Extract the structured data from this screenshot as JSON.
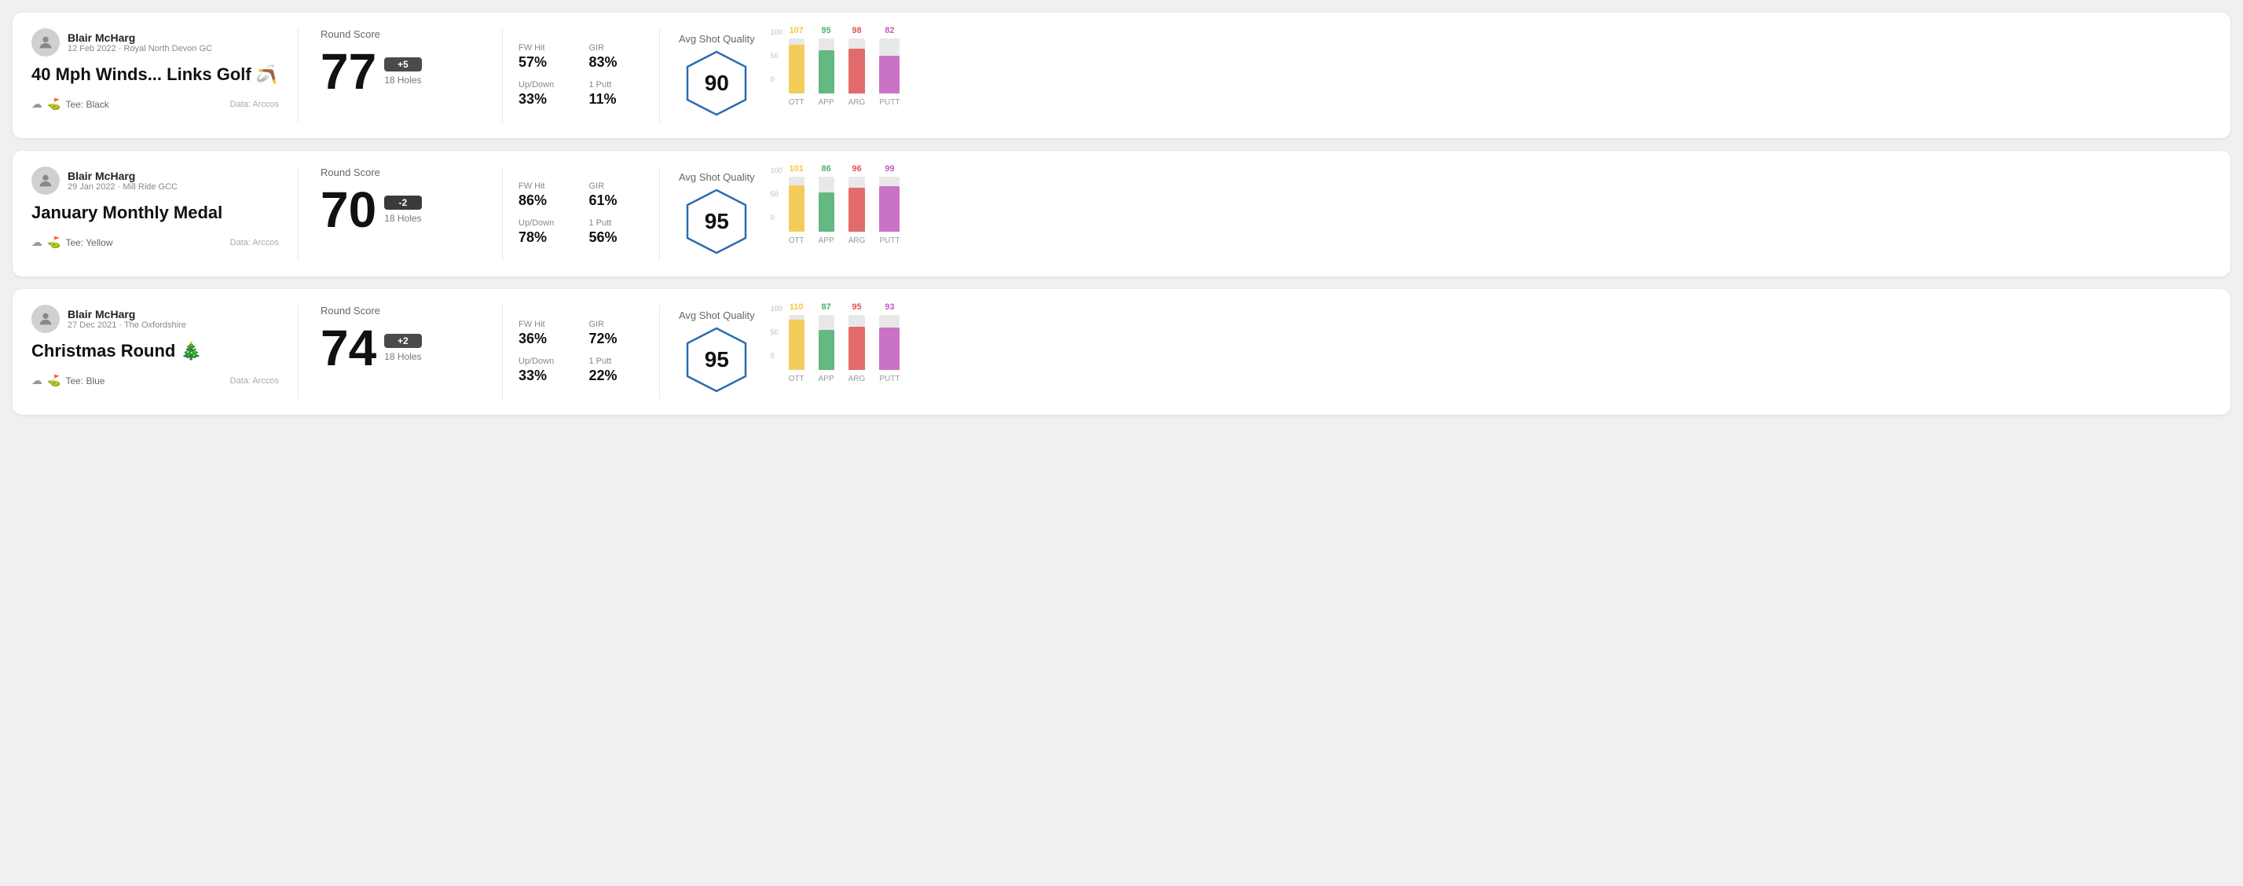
{
  "rounds": [
    {
      "id": "round-1",
      "user": {
        "name": "Blair McHarg",
        "meta": "12 Feb 2022 · Royal North Devon GC"
      },
      "title": "40 Mph Winds... Links Golf 🪃",
      "tee": "Black",
      "data_source": "Data: Arccos",
      "round_score_label": "Round Score",
      "score": "77",
      "score_diff": "+5",
      "holes": "18 Holes",
      "stats": {
        "fw_hit_label": "FW Hit",
        "fw_hit_value": "57%",
        "gir_label": "GIR",
        "gir_value": "83%",
        "updown_label": "Up/Down",
        "updown_value": "33%",
        "oneputt_label": "1 Putt",
        "oneputt_value": "11%"
      },
      "avg_shot_quality_label": "Avg Shot Quality",
      "quality_score": "90",
      "chart": {
        "bars": [
          {
            "label": "OTT",
            "value": 107,
            "color": "#f5c842"
          },
          {
            "label": "APP",
            "value": 95,
            "color": "#4caf6e"
          },
          {
            "label": "ARG",
            "value": 98,
            "color": "#e05555"
          },
          {
            "label": "PUTT",
            "value": 82,
            "color": "#c45dbe"
          }
        ]
      }
    },
    {
      "id": "round-2",
      "user": {
        "name": "Blair McHarg",
        "meta": "29 Jan 2022 · Mill Ride GCC"
      },
      "title": "January Monthly Medal",
      "tee": "Yellow",
      "data_source": "Data: Arccos",
      "round_score_label": "Round Score",
      "score": "70",
      "score_diff": "-2",
      "holes": "18 Holes",
      "stats": {
        "fw_hit_label": "FW Hit",
        "fw_hit_value": "86%",
        "gir_label": "GIR",
        "gir_value": "61%",
        "updown_label": "Up/Down",
        "updown_value": "78%",
        "oneputt_label": "1 Putt",
        "oneputt_value": "56%"
      },
      "avg_shot_quality_label": "Avg Shot Quality",
      "quality_score": "95",
      "chart": {
        "bars": [
          {
            "label": "OTT",
            "value": 101,
            "color": "#f5c842"
          },
          {
            "label": "APP",
            "value": 86,
            "color": "#4caf6e"
          },
          {
            "label": "ARG",
            "value": 96,
            "color": "#e05555"
          },
          {
            "label": "PUTT",
            "value": 99,
            "color": "#c45dbe"
          }
        ]
      }
    },
    {
      "id": "round-3",
      "user": {
        "name": "Blair McHarg",
        "meta": "27 Dec 2021 · The Oxfordshire"
      },
      "title": "Christmas Round 🎄",
      "tee": "Blue",
      "data_source": "Data: Arccos",
      "round_score_label": "Round Score",
      "score": "74",
      "score_diff": "+2",
      "holes": "18 Holes",
      "stats": {
        "fw_hit_label": "FW Hit",
        "fw_hit_value": "36%",
        "gir_label": "GIR",
        "gir_value": "72%",
        "updown_label": "Up/Down",
        "updown_value": "33%",
        "oneputt_label": "1 Putt",
        "oneputt_value": "22%"
      },
      "avg_shot_quality_label": "Avg Shot Quality",
      "quality_score": "95",
      "chart": {
        "bars": [
          {
            "label": "OTT",
            "value": 110,
            "color": "#f5c842"
          },
          {
            "label": "APP",
            "value": 87,
            "color": "#4caf6e"
          },
          {
            "label": "ARG",
            "value": 95,
            "color": "#e05555"
          },
          {
            "label": "PUTT",
            "value": 93,
            "color": "#c45dbe"
          }
        ]
      }
    }
  ],
  "chart_y_labels": [
    "100",
    "50",
    "0"
  ],
  "icons": {
    "avatar": "person",
    "weather": "☁",
    "tee": "⛳"
  }
}
